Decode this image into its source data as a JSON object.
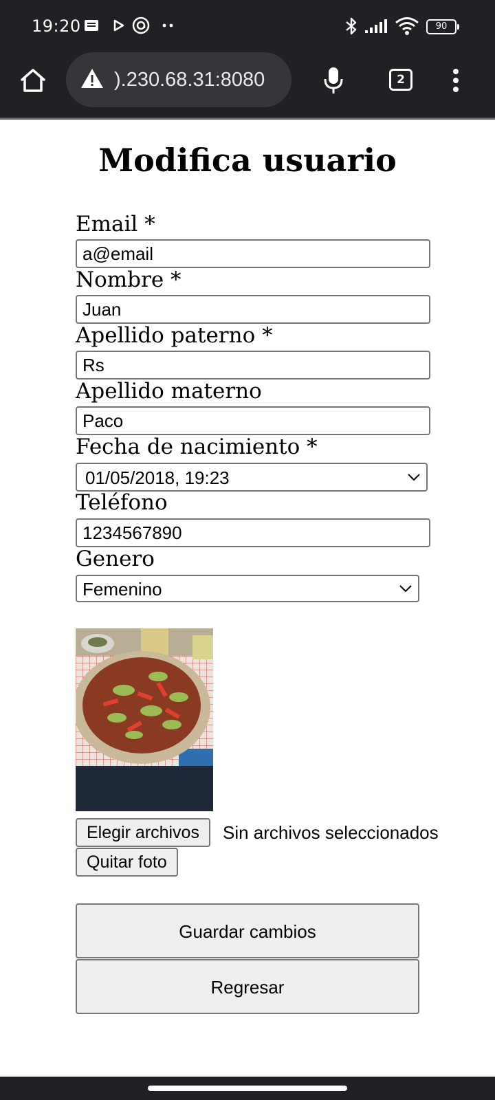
{
  "status_bar": {
    "time": "19:20",
    "battery": "90",
    "icons": [
      "notification-icon",
      "play-store-icon",
      "at-sign-icon",
      "more-dots-icon",
      "bluetooth-icon",
      "signal-icon",
      "wifi-icon",
      "battery-icon"
    ]
  },
  "browser": {
    "url": ").230.68.31:8080",
    "tab_count": "2",
    "icons": [
      "home-icon",
      "warning-icon",
      "microphone-icon",
      "tabs-icon",
      "overflow-menu-icon"
    ]
  },
  "page": {
    "title": "Modifica usuario",
    "fields": {
      "email": {
        "label": "Email *",
        "value": "a@email"
      },
      "nombre": {
        "label": "Nombre *",
        "value": "Juan"
      },
      "apellido_paterno": {
        "label": "Apellido paterno *",
        "value": "Rs"
      },
      "apellido_materno": {
        "label": "Apellido materno",
        "value": "Paco"
      },
      "fecha_nacimiento": {
        "label": "Fecha de nacimiento *",
        "value": "01/05/2018, 19:23"
      },
      "telefono": {
        "label": "Teléfono",
        "value": "1234567890"
      },
      "genero": {
        "label": "Genero",
        "value": "Femenino"
      }
    },
    "photo": {
      "description": "photo-of-tostada"
    },
    "file_picker": {
      "button_label": "Elegir archivos",
      "status": "Sin archivos seleccionados"
    },
    "remove_photo_label": "Quitar foto",
    "save_label": "Guardar cambios",
    "back_label": "Regresar"
  }
}
